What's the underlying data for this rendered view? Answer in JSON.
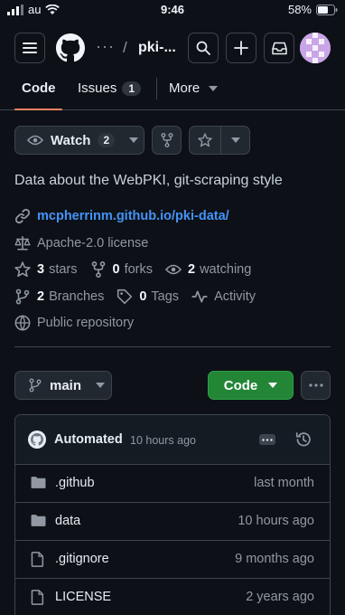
{
  "status_bar": {
    "carrier": "au",
    "time": "9:46",
    "battery": "58%"
  },
  "header": {
    "breadcrumb_more": "···",
    "breadcrumb_separator": "/",
    "repo_name": "pki-..."
  },
  "tabs": [
    {
      "label": "Code"
    },
    {
      "label": "Issues",
      "count": "1"
    },
    {
      "label": "More"
    }
  ],
  "actions": {
    "watch_label": "Watch",
    "watch_count": "2"
  },
  "repo": {
    "description": "Data about the WebPKI, git-scraping style",
    "website": "mcpherrinm.github.io/pki-data/",
    "license": "Apache-2.0 license",
    "stars_count": "3",
    "stars_label": "stars",
    "forks_count": "0",
    "forks_label": "forks",
    "watching_count": "2",
    "watching_label": "watching",
    "branches_count": "2",
    "branches_label": "Branches",
    "tags_count": "0",
    "tags_label": "Tags",
    "activity_label": "Activity",
    "visibility": "Public repository"
  },
  "branch_bar": {
    "branch": "main",
    "code_button": "Code"
  },
  "latest_commit": {
    "author": "Automated",
    "time": "10 hours ago"
  },
  "files": [
    {
      "name": ".github",
      "type": "folder",
      "updated": "last month"
    },
    {
      "name": "data",
      "type": "folder",
      "updated": "10 hours ago"
    },
    {
      "name": ".gitignore",
      "type": "file",
      "updated": "9 months ago"
    },
    {
      "name": "LICENSE",
      "type": "file",
      "updated": "2 years ago"
    }
  ],
  "colors": {
    "background": "#0d1117",
    "accent_link": "#4493f8",
    "tab_underline": "#f78166",
    "code_button": "#238636"
  }
}
